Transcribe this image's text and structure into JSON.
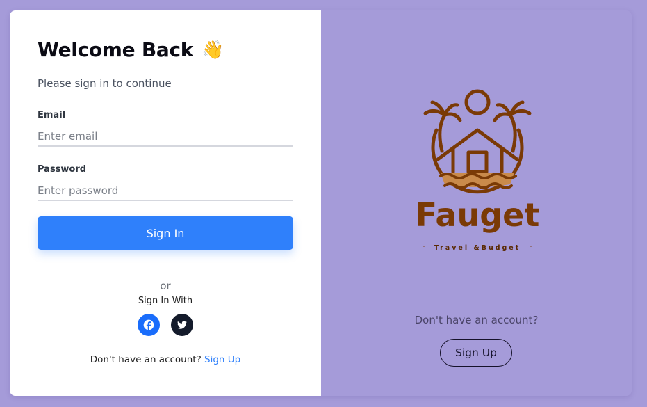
{
  "login": {
    "title": "Welcome Back",
    "wave_emoji": "👋",
    "subtitle": "Please sign in to continue",
    "email_label": "Email",
    "email_placeholder": "Enter email",
    "email_value": "",
    "password_label": "Password",
    "password_placeholder": "Enter password",
    "password_value": "",
    "signin_label": "Sign In",
    "or_text": "or",
    "signin_with_text": "Sign In With",
    "social": [
      "facebook-icon",
      "twitter-icon"
    ],
    "no_account_text": "Don't have an account?",
    "signup_link": "Sign Up"
  },
  "brand": {
    "name": "Fauget",
    "tagline": "Travel &Budget",
    "logo_color": "#7a3a06",
    "panel_color": "#a59bd9",
    "no_account_text": "Don't have an account?",
    "signup_label": "Sign Up"
  },
  "colors": {
    "accent": "#2f80fb",
    "facebook": "#1a6dfb",
    "twitter": "#141b2b"
  }
}
